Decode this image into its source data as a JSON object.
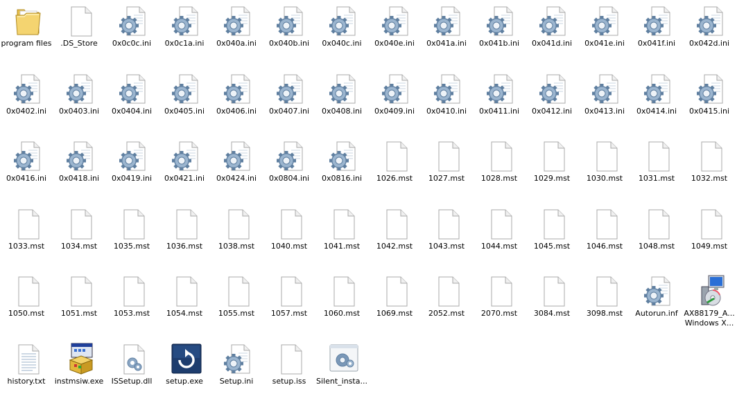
{
  "window": {
    "view": "Large icons"
  },
  "files": [
    {
      "name": "program files",
      "icon": "folder-icon"
    },
    {
      "name": ".DS_Store",
      "icon": "blank-document-icon"
    },
    {
      "name": "0x0c0c.ini",
      "icon": "settings-file-icon"
    },
    {
      "name": "0x0c1a.ini",
      "icon": "settings-file-icon"
    },
    {
      "name": "0x040a.ini",
      "icon": "settings-file-icon"
    },
    {
      "name": "0x040b.ini",
      "icon": "settings-file-icon"
    },
    {
      "name": "0x040c.ini",
      "icon": "settings-file-icon"
    },
    {
      "name": "0x040e.ini",
      "icon": "settings-file-icon"
    },
    {
      "name": "0x041a.ini",
      "icon": "settings-file-icon"
    },
    {
      "name": "0x041b.ini",
      "icon": "settings-file-icon"
    },
    {
      "name": "0x041d.ini",
      "icon": "settings-file-icon"
    },
    {
      "name": "0x041e.ini",
      "icon": "settings-file-icon"
    },
    {
      "name": "0x041f.ini",
      "icon": "settings-file-icon"
    },
    {
      "name": "0x042d.ini",
      "icon": "settings-file-icon"
    },
    {
      "name": "0x0402.ini",
      "icon": "settings-file-icon"
    },
    {
      "name": "0x0403.ini",
      "icon": "settings-file-icon"
    },
    {
      "name": "0x0404.ini",
      "icon": "settings-file-icon"
    },
    {
      "name": "0x0405.ini",
      "icon": "settings-file-icon"
    },
    {
      "name": "0x0406.ini",
      "icon": "settings-file-icon"
    },
    {
      "name": "0x0407.ini",
      "icon": "settings-file-icon"
    },
    {
      "name": "0x0408.ini",
      "icon": "settings-file-icon"
    },
    {
      "name": "0x0409.ini",
      "icon": "settings-file-icon"
    },
    {
      "name": "0x0410.ini",
      "icon": "settings-file-icon"
    },
    {
      "name": "0x0411.ini",
      "icon": "settings-file-icon"
    },
    {
      "name": "0x0412.ini",
      "icon": "settings-file-icon"
    },
    {
      "name": "0x0413.ini",
      "icon": "settings-file-icon"
    },
    {
      "name": "0x0414.ini",
      "icon": "settings-file-icon"
    },
    {
      "name": "0x0415.ini",
      "icon": "settings-file-icon"
    },
    {
      "name": "0x0416.ini",
      "icon": "settings-file-icon"
    },
    {
      "name": "0x0418.ini",
      "icon": "settings-file-icon"
    },
    {
      "name": "0x0419.ini",
      "icon": "settings-file-icon"
    },
    {
      "name": "0x0421.ini",
      "icon": "settings-file-icon"
    },
    {
      "name": "0x0424.ini",
      "icon": "settings-file-icon"
    },
    {
      "name": "0x0804.ini",
      "icon": "settings-file-icon"
    },
    {
      "name": "0x0816.ini",
      "icon": "settings-file-icon"
    },
    {
      "name": "1026.mst",
      "icon": "blank-document-icon"
    },
    {
      "name": "1027.mst",
      "icon": "blank-document-icon"
    },
    {
      "name": "1028.mst",
      "icon": "blank-document-icon"
    },
    {
      "name": "1029.mst",
      "icon": "blank-document-icon"
    },
    {
      "name": "1030.mst",
      "icon": "blank-document-icon"
    },
    {
      "name": "1031.mst",
      "icon": "blank-document-icon"
    },
    {
      "name": "1032.mst",
      "icon": "blank-document-icon"
    },
    {
      "name": "1033.mst",
      "icon": "blank-document-icon"
    },
    {
      "name": "1034.mst",
      "icon": "blank-document-icon"
    },
    {
      "name": "1035.mst",
      "icon": "blank-document-icon"
    },
    {
      "name": "1036.mst",
      "icon": "blank-document-icon"
    },
    {
      "name": "1038.mst",
      "icon": "blank-document-icon"
    },
    {
      "name": "1040.mst",
      "icon": "blank-document-icon"
    },
    {
      "name": "1041.mst",
      "icon": "blank-document-icon"
    },
    {
      "name": "1042.mst",
      "icon": "blank-document-icon"
    },
    {
      "name": "1043.mst",
      "icon": "blank-document-icon"
    },
    {
      "name": "1044.mst",
      "icon": "blank-document-icon"
    },
    {
      "name": "1045.mst",
      "icon": "blank-document-icon"
    },
    {
      "name": "1046.mst",
      "icon": "blank-document-icon"
    },
    {
      "name": "1048.mst",
      "icon": "blank-document-icon"
    },
    {
      "name": "1049.mst",
      "icon": "blank-document-icon"
    },
    {
      "name": "1050.mst",
      "icon": "blank-document-icon"
    },
    {
      "name": "1051.mst",
      "icon": "blank-document-icon"
    },
    {
      "name": "1053.mst",
      "icon": "blank-document-icon"
    },
    {
      "name": "1054.mst",
      "icon": "blank-document-icon"
    },
    {
      "name": "1055.mst",
      "icon": "blank-document-icon"
    },
    {
      "name": "1057.mst",
      "icon": "blank-document-icon"
    },
    {
      "name": "1060.mst",
      "icon": "blank-document-icon"
    },
    {
      "name": "1069.mst",
      "icon": "blank-document-icon"
    },
    {
      "name": "2052.mst",
      "icon": "blank-document-icon"
    },
    {
      "name": "2070.mst",
      "icon": "blank-document-icon"
    },
    {
      "name": "3084.mst",
      "icon": "blank-document-icon"
    },
    {
      "name": "3098.mst",
      "icon": "blank-document-icon"
    },
    {
      "name": "Autorun.inf",
      "icon": "settings-file-icon"
    },
    {
      "name": "AX88179_A...",
      "name2": "Windows X...",
      "icon": "installer-computer-cd-icon"
    },
    {
      "name": "history.txt",
      "icon": "text-document-icon"
    },
    {
      "name": "instmsiw.exe",
      "icon": "installer-box-icon"
    },
    {
      "name": "ISSetup.dll",
      "icon": "dll-file-icon"
    },
    {
      "name": "setup.exe",
      "icon": "setup-arrow-icon"
    },
    {
      "name": "Setup.ini",
      "icon": "settings-file-icon"
    },
    {
      "name": "setup.iss",
      "icon": "blank-document-icon"
    },
    {
      "name": "Silent_insta...",
      "icon": "script-gear-icon"
    }
  ]
}
